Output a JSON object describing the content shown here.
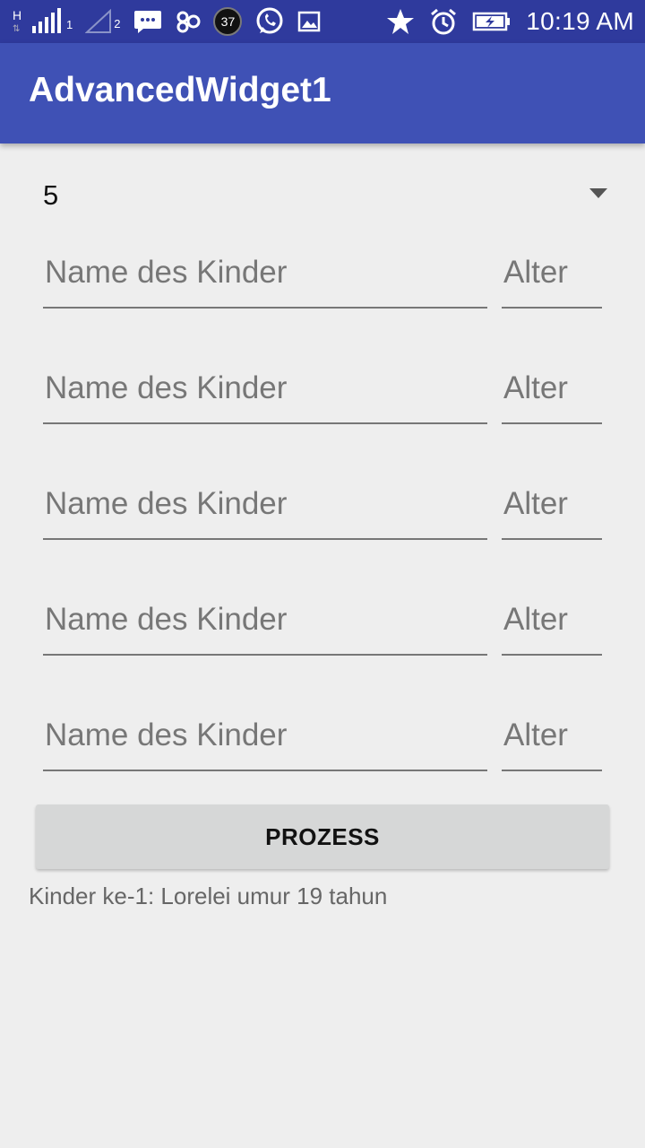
{
  "status_bar": {
    "network_label": "H",
    "sim1": "1",
    "sim2": "2",
    "badge": "37",
    "time": "10:19 AM",
    "icons": [
      "signal-icon",
      "signal-empty-icon",
      "message-icon",
      "infinity-icon",
      "notification-37-icon",
      "whatsapp-icon",
      "image-icon",
      "star-icon",
      "alarm-icon",
      "battery-charging-icon"
    ]
  },
  "app_bar": {
    "title": "AdvancedWidget1"
  },
  "spinner": {
    "selected": "5"
  },
  "children_form": {
    "rows": [
      {
        "name_placeholder": "Name des Kinder",
        "age_placeholder": "Alter"
      },
      {
        "name_placeholder": "Name des Kinder",
        "age_placeholder": "Alter"
      },
      {
        "name_placeholder": "Name des Kinder",
        "age_placeholder": "Alter"
      },
      {
        "name_placeholder": "Name des Kinder",
        "age_placeholder": "Alter"
      },
      {
        "name_placeholder": "Name des Kinder",
        "age_placeholder": "Alter"
      }
    ]
  },
  "process_button": {
    "label": "PROZESS"
  },
  "result": {
    "text": "Kinder ke-1: Lorelei umur 19 tahun"
  },
  "colors": {
    "status_bar": "#2f3a9d",
    "app_bar": "#3f51b5",
    "background": "#eeeeee",
    "button": "#d6d7d7"
  }
}
